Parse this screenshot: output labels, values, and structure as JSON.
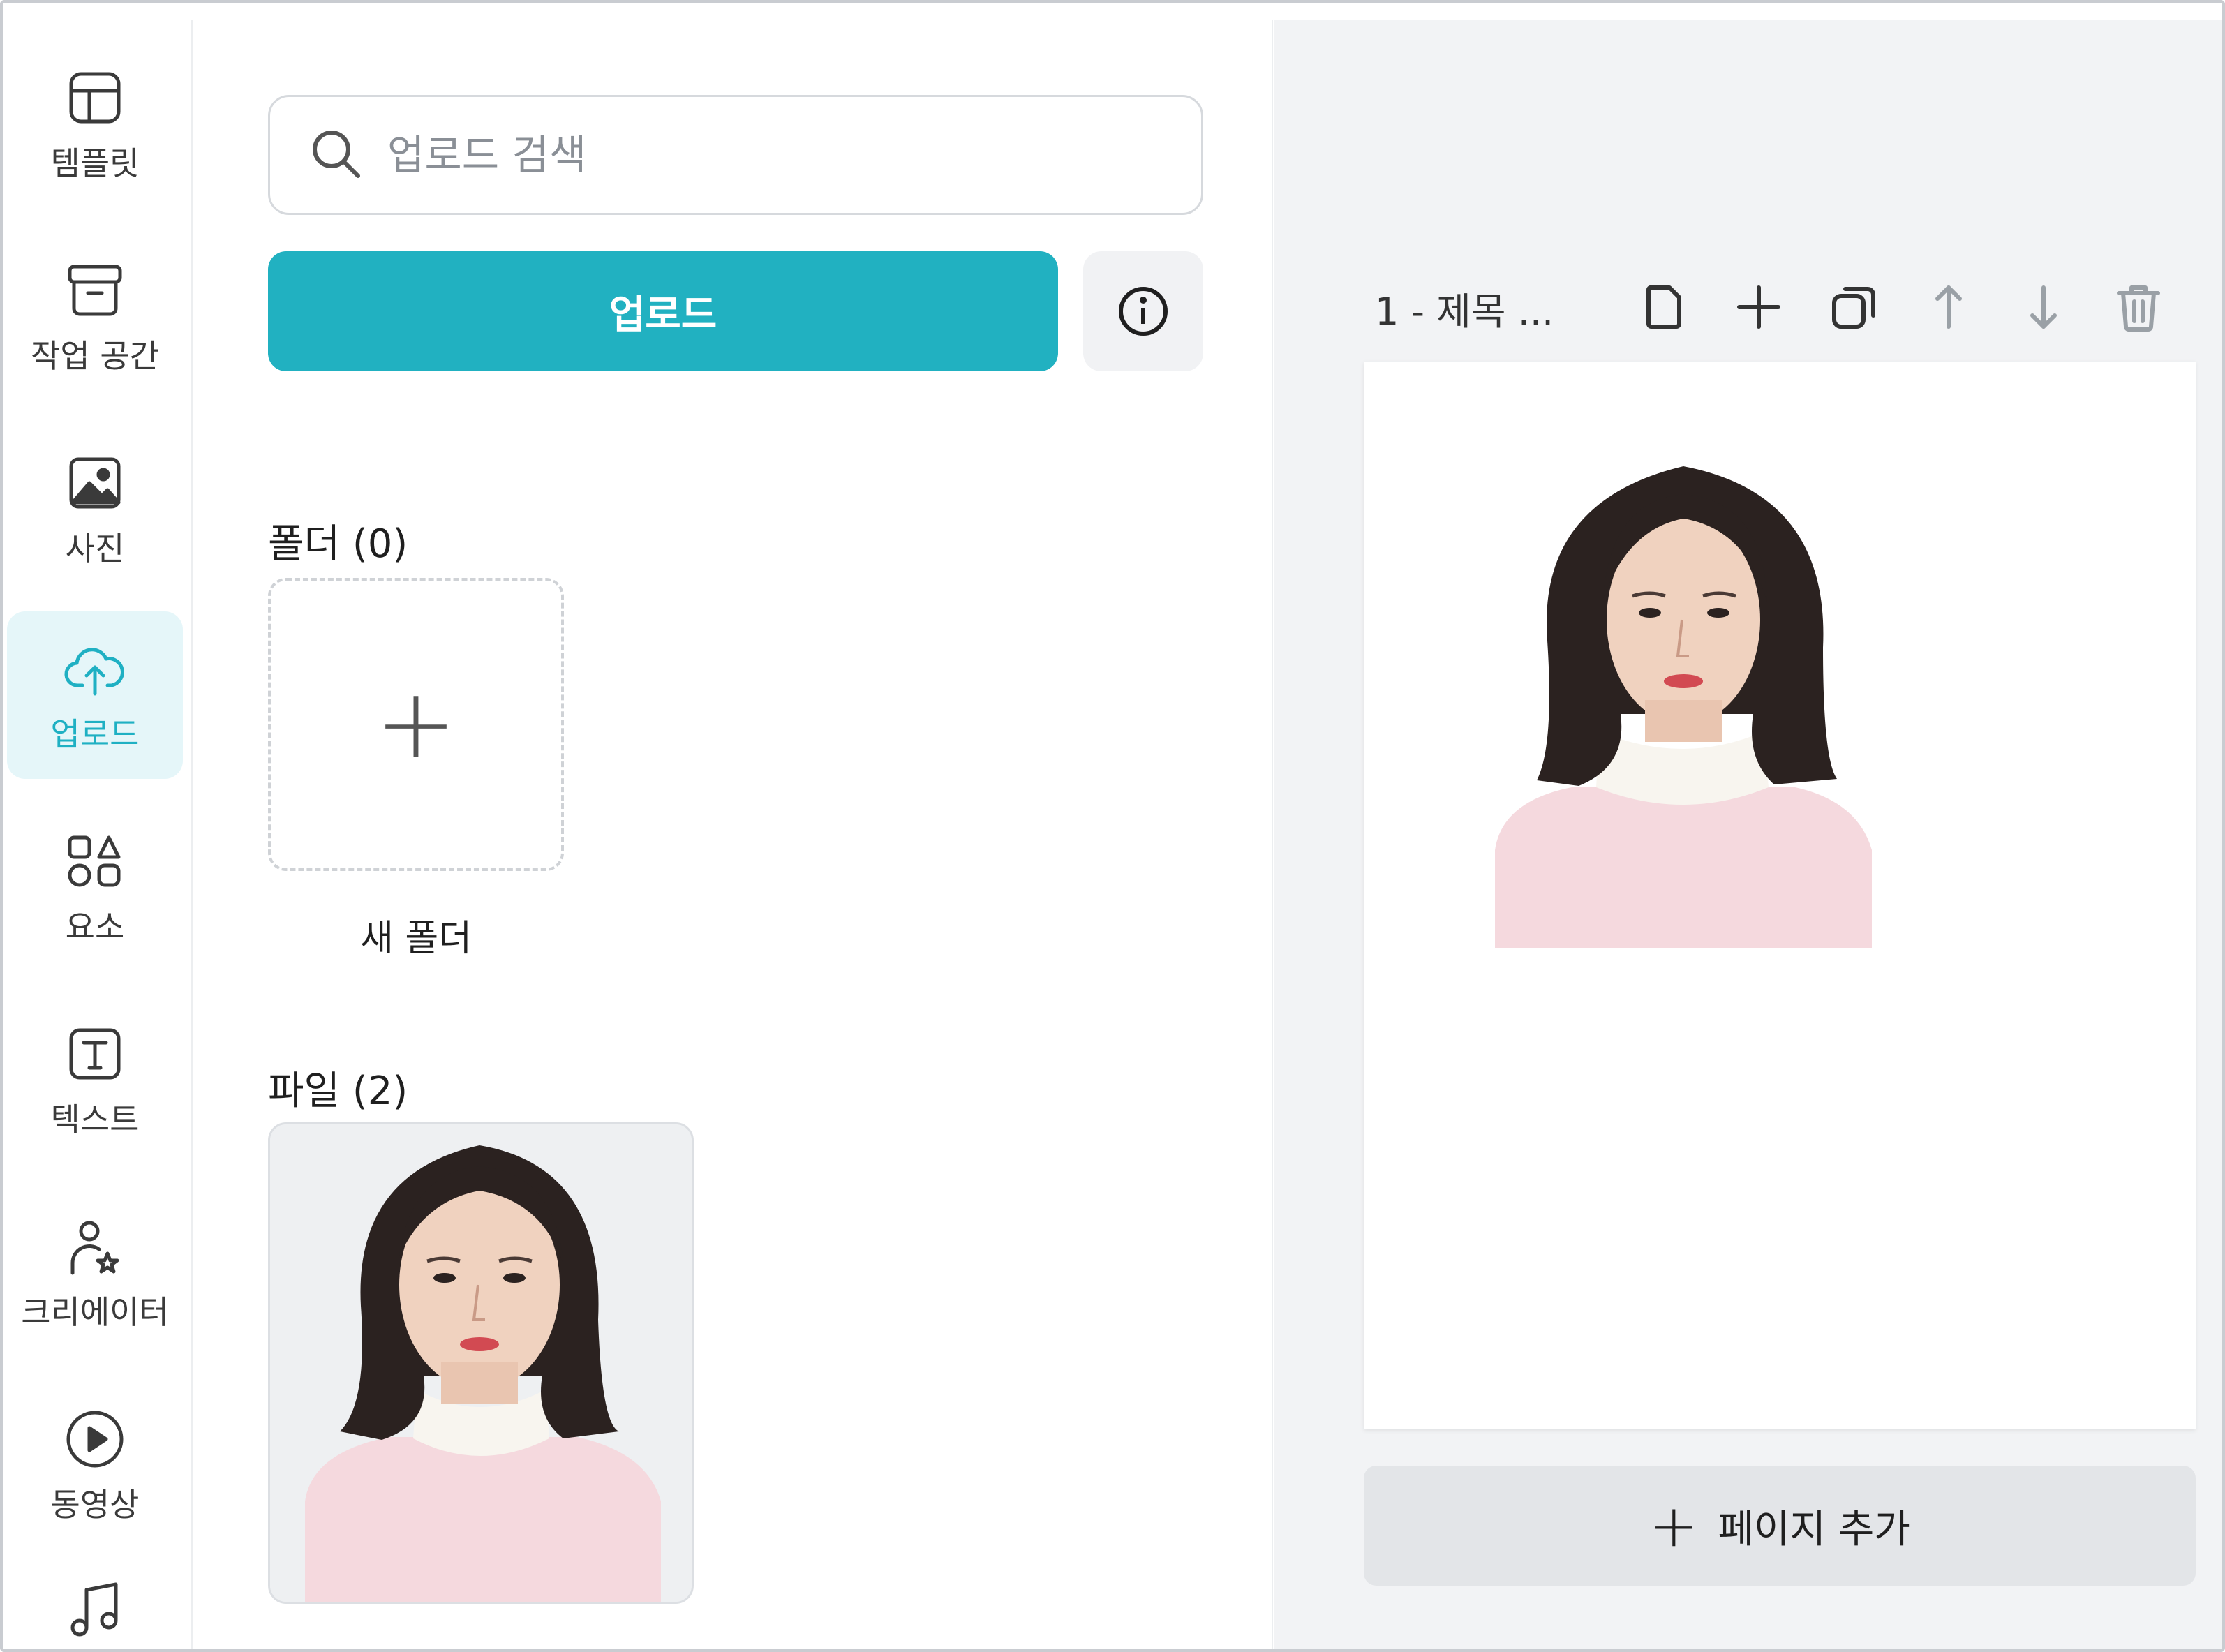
{
  "sidebar": {
    "items": [
      {
        "label": "템플릿",
        "icon": "layout-icon"
      },
      {
        "label": "작업 공간",
        "icon": "archive-box-icon"
      },
      {
        "label": "사진",
        "icon": "photo-icon"
      },
      {
        "label": "업로드",
        "icon": "cloud-upload-icon",
        "active": true
      },
      {
        "label": "요소",
        "icon": "shapes-icon"
      },
      {
        "label": "텍스트",
        "icon": "text-icon"
      },
      {
        "label": "크리에이터",
        "icon": "creator-icon"
      },
      {
        "label": "동영상",
        "icon": "play-circle-icon"
      },
      {
        "label": "",
        "icon": "music-note-icon"
      }
    ]
  },
  "uploads": {
    "search_placeholder": "업로드 검색",
    "upload_button": "업로드",
    "folders_title": "폴더 (0)",
    "new_folder_label": "새 폴더",
    "files_title": "파일 (2)"
  },
  "canvas": {
    "page_title": "1 - 제목 ...",
    "add_page_label": "페이지 추가"
  },
  "colors": {
    "accent": "#21b1c1",
    "active_bg": "#e5f6f9",
    "canvas_bg": "#f2f3f5"
  }
}
